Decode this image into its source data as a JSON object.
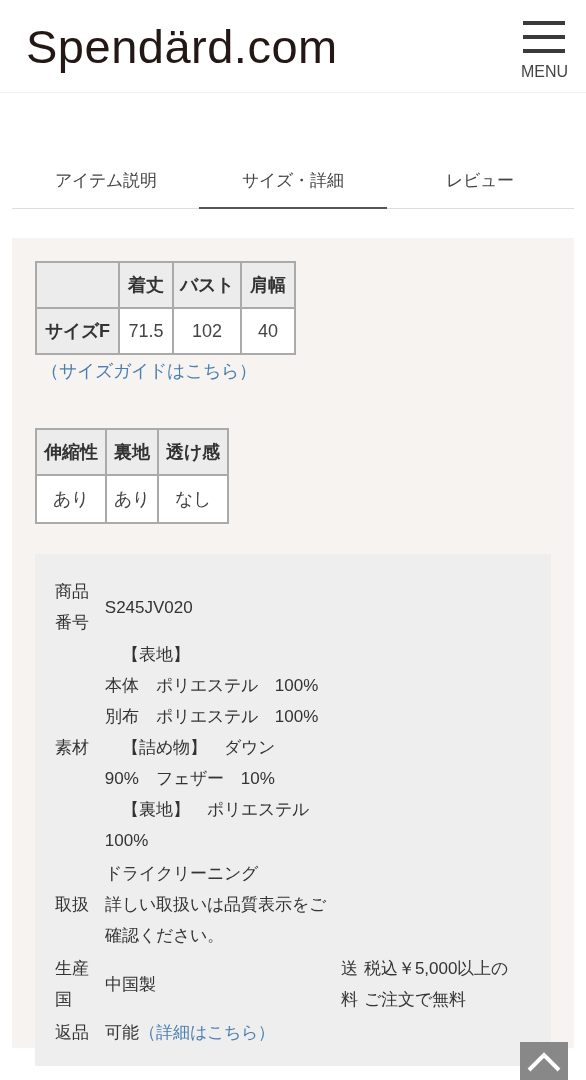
{
  "header": {
    "logo": "Spendärd.com",
    "menu_label": "MENU"
  },
  "tabs": [
    {
      "label": "アイテム説明",
      "selected": false
    },
    {
      "label": "サイズ・詳細",
      "selected": true
    },
    {
      "label": "レビュー",
      "selected": false
    }
  ],
  "size_table": {
    "columns": [
      "着丈",
      "バスト",
      "肩幅"
    ],
    "rows": [
      {
        "label": "サイズF",
        "cells": [
          "71.5",
          "102",
          "40"
        ]
      }
    ]
  },
  "size_guide_link": "（サイズガイドはこちら）",
  "feature_table": {
    "columns": [
      "伸縮性",
      "裏地",
      "透け感"
    ],
    "cells": [
      "あり",
      "あり",
      "なし"
    ]
  },
  "details": [
    {
      "label": "商品番号",
      "lines": [
        "S245JV020"
      ]
    },
    {
      "label": "素材",
      "lines": [
        "　【表地】",
        "本体　ポリエステル　100%",
        "別布　ポリエステル　100%",
        "　【詰め物】　ダウン",
        "90%　フェザー　10%",
        "　【裏地】　ポリエステル",
        "100%"
      ]
    },
    {
      "label": "取扱",
      "lines": [
        "ドライクリーニング",
        "詳しい取扱いは品質表示をご",
        "確認ください。"
      ]
    },
    {
      "label": "生産国",
      "lines": [
        "中国製"
      ],
      "extra": {
        "label": "送料",
        "lines": [
          "税込￥5,000以上の",
          "ご注文で無料"
        ]
      }
    },
    {
      "label": "返品",
      "lines": [
        "可能"
      ],
      "link": "（詳細はこちら）"
    }
  ]
}
